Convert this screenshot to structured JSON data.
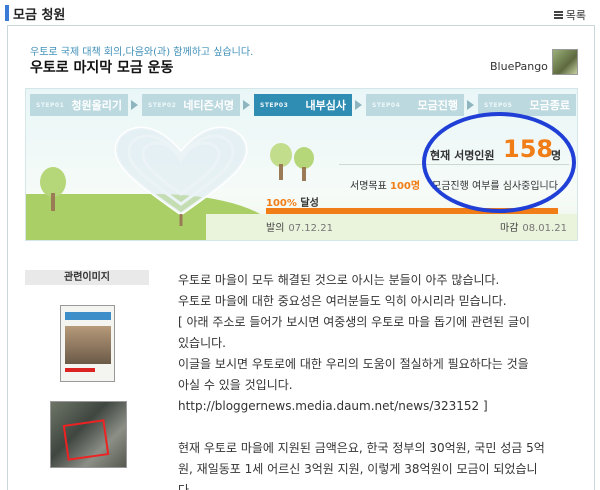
{
  "header": {
    "section_title": "모금 청원",
    "list_label": "목록"
  },
  "campaign": {
    "subtitle": "우토로 국제 대책 회의,다음와(과) 함께하고 싶습니다.",
    "title": "우토로 마지막 모금 운동",
    "author": "BluePango"
  },
  "steps": [
    {
      "no": "STEP01",
      "label": "청원올리기",
      "active": false
    },
    {
      "no": "STEP02",
      "label": "네티즌서명",
      "active": false
    },
    {
      "no": "STEP03",
      "label": "내부심사",
      "active": true
    },
    {
      "no": "STEP04",
      "label": "모금진행",
      "active": false
    },
    {
      "no": "STEP05",
      "label": "모금종료",
      "active": false
    }
  ],
  "stats": {
    "current_label": "현재 서명인원",
    "current_count": "158",
    "current_unit": "명",
    "goal_label": "서명목표",
    "goal_value": "100명",
    "review_status": "모금진행 여부를 심사중입니다",
    "achieve_percent": "100%",
    "achieve_label": "달성",
    "progress": 1.0
  },
  "dates": {
    "start_label": "발의",
    "start_date": "07.12.21",
    "end_label": "마감",
    "end_date": "08.01.21"
  },
  "related_images": {
    "title": "관련이미지"
  },
  "body": {
    "p1": [
      "우토로 마을이 모두 해결된 것으로 아시는 분들이 아주 많습니다.",
      "우토로 마을에 대한 중요성은 여러분들도 익히 아시리라 믿습니다.",
      "[ 아래 주소로 들어가 보시면 여중생의 우토로 마을 돕기에 관련된 글이",
      "있습니다.",
      "이글을 보시면 우토로에 대한 우리의 도움이 절실하게 필요하다는 것을",
      "아실 수 있을 것입니다.",
      "http://bloggernews.media.daum.net/news/323152 ]"
    ],
    "p2": [
      "현재 우토로 마을에 지원된 금액은요, 한국 정부의 30억원, 국민 성금 5억",
      "원, 재일동포 1세 어르신 3억원 지원, 이렇게 38억원이 모금이 되었습니",
      "다."
    ]
  },
  "colors": {
    "accent": "#f07d16",
    "step_active": "#2f8cb3",
    "step_inactive": "#bcd9df",
    "circle": "#1f3fd6"
  }
}
